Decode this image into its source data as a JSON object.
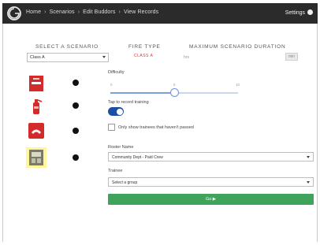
{
  "topbar": {
    "breadcrumb": [
      "Home",
      "Scenarios",
      "Edit Buddors",
      "View Records"
    ],
    "separator": "›",
    "settings_label": "Settings"
  },
  "headers": {
    "select_scenario": "SELECT A SCENARIO",
    "fire_type": "FIRE TYPE",
    "max_duration": "MAXIMUM SCENARIO DURATION"
  },
  "scenario_select": {
    "value": "Class A"
  },
  "fire_type_value": "CLASS A",
  "duration": {
    "unit": "hrs",
    "value": "min"
  },
  "icons": [
    "fire-alarm-pull-station-icon",
    "fire-extinguisher-icon",
    "emergency-phone-icon",
    "control-panel-icon"
  ],
  "difficulty": {
    "label": "Difficulty",
    "ticks": [
      "0",
      "5",
      "10"
    ],
    "level": 0.5
  },
  "record_training": {
    "label": "Tap to record training",
    "enabled": true
  },
  "only_show": {
    "label": "Only show trainees that haven't passed",
    "checked": false
  },
  "roster": {
    "label": "Roster Name",
    "value": "Community Dept - Paid Crew"
  },
  "trainee": {
    "label": "Trainee",
    "value": "Select a group"
  },
  "go_button": "Go ▶",
  "colors": {
    "topbar": "#2b2b2b",
    "accent_blue": "#1b4fa3",
    "go_green": "#3fa35c",
    "fire_red": "#d23a3a"
  }
}
